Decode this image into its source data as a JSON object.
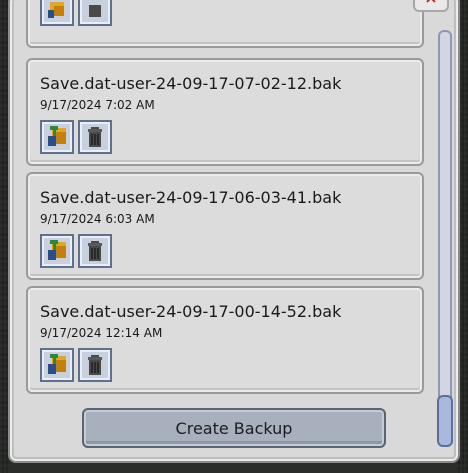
{
  "window": {
    "close_label": "×"
  },
  "backups": [
    {
      "name": "Save.dat-user-24-09-17-07-02-12.bak",
      "date": "9/17/2024 7:02 AM"
    },
    {
      "name": "Save.dat-user-24-09-17-06-03-41.bak",
      "date": "9/17/2024 6:03 AM"
    },
    {
      "name": "Save.dat-user-24-09-17-00-14-52.bak",
      "date": "9/17/2024 12:14 AM"
    }
  ],
  "actions": {
    "create_backup_label": "Create Backup"
  },
  "icons": {
    "restore": "restore-icon",
    "delete": "trash-icon"
  },
  "colors": {
    "panel": "#d9d9d9",
    "button": "#a8afbd",
    "accent": "#5b6e9b",
    "close": "#b52525"
  }
}
